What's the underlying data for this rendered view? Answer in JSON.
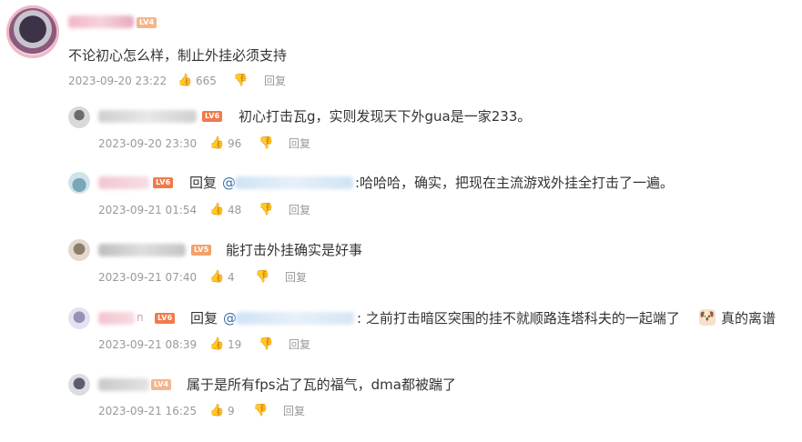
{
  "colors": {
    "text": "#333333",
    "meta": "#999999",
    "mention": "#3b6fa8",
    "level_badge": "#f08a4b"
  },
  "main_comment": {
    "level": "LV4",
    "text": "不论初心怎么样，制止外挂必须支持",
    "time": "2023-09-20 23:22",
    "likes": "665",
    "reply": "回复",
    "icons": [
      "thumbs-up-icon",
      "comment-icon"
    ]
  },
  "replies": [
    {
      "level": "LV6",
      "text": "初心打击瓦g，实则发现天下外gua是一家233。",
      "time": "2023-09-20 23:30",
      "likes": "96",
      "reply": "回复"
    },
    {
      "level": "LV6",
      "reply_prefix": "回复",
      "mention": "@",
      "text_after": ":哈哈哈，确实，把现在主流游戏外挂全打击了一遍。",
      "time": "2023-09-21 01:54",
      "likes": "48",
      "reply": "回复"
    },
    {
      "level": "LV5",
      "text": "能打击外挂确实是好事",
      "time": "2023-09-21 07:40",
      "likes": "4",
      "reply": "回复"
    },
    {
      "level": "LV6",
      "name_suffix": "n",
      "reply_prefix": "回复",
      "mention": "@",
      "text_after": ": 之前打击暗区突围的挂不就顺路连塔科夫的一起端了",
      "text_tail": "真的离谱",
      "time": "2023-09-21 08:39",
      "likes": "19",
      "reply": "回复"
    },
    {
      "level": "LV4",
      "text": "属于是所有fps沾了瓦的福气，dma都被踹了",
      "time": "2023-09-21 16:25",
      "likes": "9",
      "reply": "回复"
    }
  ]
}
